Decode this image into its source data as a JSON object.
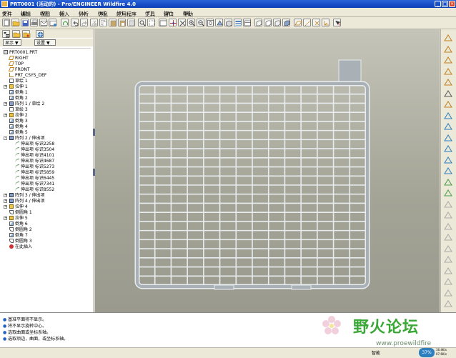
{
  "window": {
    "title": "PRT0001 (活动的) - Pro/ENGINEER Wildfire 4.0",
    "minimize_symbol": "_",
    "maximize_symbol": "□",
    "close_symbol": "×"
  },
  "menu": {
    "items": [
      "文件",
      "编辑",
      "视图",
      "插入",
      "分析",
      "信息",
      "应用程序",
      "工具",
      "窗口",
      "帮助"
    ],
    "mnemonics": [
      "(F)",
      "(E)",
      "(V)",
      "(I)",
      "(A)",
      "(N)",
      "(P)",
      "(T)",
      "(W)",
      "(H)"
    ]
  },
  "navigator": {
    "show_dropdown": "显示",
    "settings_dropdown": "设置",
    "dropdown_arrow": "▼"
  },
  "model_tree": {
    "items": [
      {
        "label": "PRT0001.PRT",
        "indent": 0,
        "icon": "part-icon",
        "expander": ""
      },
      {
        "label": "RIGHT",
        "indent": 1,
        "icon": "datum-plane-icon",
        "expander": ""
      },
      {
        "label": "TOP",
        "indent": 1,
        "icon": "datum-plane-icon",
        "expander": ""
      },
      {
        "label": "FRONT",
        "indent": 1,
        "icon": "datum-plane-icon",
        "expander": ""
      },
      {
        "label": "PRT_CSYS_DEF",
        "indent": 1,
        "icon": "csys-icon",
        "expander": ""
      },
      {
        "label": "草绘 1",
        "indent": 1,
        "icon": "sketch-icon",
        "expander": ""
      },
      {
        "label": "拉伸 1",
        "indent": 1,
        "icon": "extrude-icon",
        "expander": "+"
      },
      {
        "label": "倒角 1",
        "indent": 1,
        "icon": "chamfer-icon",
        "expander": ""
      },
      {
        "label": "倒角 2",
        "indent": 1,
        "icon": "chamfer-icon",
        "expander": ""
      },
      {
        "label": "阵列 1 / 草绘 2",
        "indent": 1,
        "icon": "pattern-icon",
        "expander": "+"
      },
      {
        "label": "草绘 3",
        "indent": 1,
        "icon": "sketch-icon",
        "expander": ""
      },
      {
        "label": "拉伸 2",
        "indent": 1,
        "icon": "extrude-icon",
        "expander": "+"
      },
      {
        "label": "倒角 3",
        "indent": 1,
        "icon": "chamfer-icon",
        "expander": ""
      },
      {
        "label": "倒角 4",
        "indent": 1,
        "icon": "chamfer-icon",
        "expander": ""
      },
      {
        "label": "倒角 5",
        "indent": 1,
        "icon": "chamfer-icon",
        "expander": ""
      },
      {
        "label": "阵列 2 / 伸出项",
        "indent": 1,
        "icon": "pattern-icon",
        "expander": "-"
      },
      {
        "label": "伸出项 标识2258",
        "indent": 2,
        "icon": "sweep-icon",
        "expander": ""
      },
      {
        "label": "伸出项 标识3504",
        "indent": 2,
        "icon": "sweep-icon",
        "expander": ""
      },
      {
        "label": "伸出项 标识4101",
        "indent": 2,
        "icon": "sweep-icon",
        "expander": ""
      },
      {
        "label": "伸出项 标识4687",
        "indent": 2,
        "icon": "sweep-icon",
        "expander": ""
      },
      {
        "label": "伸出项 标识5273",
        "indent": 2,
        "icon": "sweep-icon",
        "expander": ""
      },
      {
        "label": "伸出项 标识5859",
        "indent": 2,
        "icon": "sweep-icon",
        "expander": ""
      },
      {
        "label": "伸出项 标识6445",
        "indent": 2,
        "icon": "sweep-icon",
        "expander": ""
      },
      {
        "label": "伸出项 标识7341",
        "indent": 2,
        "icon": "sweep-icon",
        "expander": ""
      },
      {
        "label": "伸出项 标识8552",
        "indent": 2,
        "icon": "sweep-icon",
        "expander": ""
      },
      {
        "label": "阵列 3 / 伸出项",
        "indent": 1,
        "icon": "pattern-icon",
        "expander": "+"
      },
      {
        "label": "阵列 4 / 伸出项",
        "indent": 1,
        "icon": "pattern-icon",
        "expander": "+"
      },
      {
        "label": "拉伸 4",
        "indent": 1,
        "icon": "extrude-icon",
        "expander": "+"
      },
      {
        "label": "倒圆角 1",
        "indent": 1,
        "icon": "round-icon",
        "expander": ""
      },
      {
        "label": "拉伸 5",
        "indent": 1,
        "icon": "extrude-icon",
        "expander": "+"
      },
      {
        "label": "倒角 6",
        "indent": 1,
        "icon": "chamfer-icon",
        "expander": ""
      },
      {
        "label": "倒圆角 2",
        "indent": 1,
        "icon": "round-icon",
        "expander": ""
      },
      {
        "label": "倒角 7",
        "indent": 1,
        "icon": "chamfer-icon",
        "expander": ""
      },
      {
        "label": "倒圆角 3",
        "indent": 1,
        "icon": "round-icon",
        "expander": ""
      },
      {
        "label": "在此插入",
        "indent": 1,
        "icon": "insert-here-icon",
        "expander": ""
      }
    ]
  },
  "messages": [
    "基准平面将不显示。",
    "将不显示旋转中心。",
    "选取曲面或坐标系轴。",
    "选取项边，曲面，或坐标系轴。"
  ],
  "status": {
    "filter_label": "智能",
    "watermark_text": "野火论坛",
    "watermark_url": "www.proewildfire",
    "cpu_percent": "37%",
    "net_up": "16.4K/s",
    "net_down": "07.6K/s"
  },
  "colors": {
    "titlebar": "#0a3fb8",
    "viewport_top": "#c4c4b8",
    "viewport_bottom": "#9a9a8e",
    "model_edge": "#ffffff",
    "model_face": "#a9b0b6",
    "watermark_green": "#3aa836",
    "watermark_red": "#d84040"
  }
}
